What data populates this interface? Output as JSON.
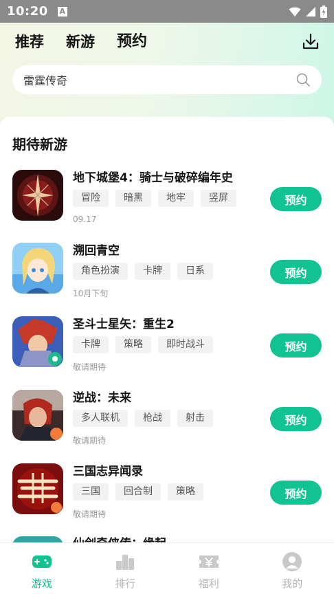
{
  "status_bar": {
    "time": "10:20",
    "notification_badge": "A",
    "icons": [
      "wifi-icon",
      "signal-icon",
      "battery-charging-icon"
    ]
  },
  "header": {
    "tabs": [
      {
        "label": "推荐",
        "active": false
      },
      {
        "label": "新游",
        "active": false
      },
      {
        "label": "预约",
        "active": true
      }
    ],
    "download_icon": "download-icon"
  },
  "search": {
    "text": "雷霆传奇",
    "icon": "search-icon"
  },
  "section": {
    "title": "期待新游"
  },
  "games": [
    {
      "name": "地下城堡4：骑士与破碎编年史",
      "tags": [
        "冒险",
        "暗黑",
        "地牢",
        "竖屏"
      ],
      "date": "09.17",
      "button": "预约"
    },
    {
      "name": "溯回青空",
      "tags": [
        "角色扮演",
        "卡牌",
        "日系"
      ],
      "date": "10月下旬",
      "button": "预约"
    },
    {
      "name": "圣斗士星矢：重生2",
      "tags": [
        "卡牌",
        "策略",
        "即时战斗"
      ],
      "date": "敬请期待",
      "button": "预约"
    },
    {
      "name": "逆战：未来",
      "tags": [
        "多人联机",
        "枪战",
        "射击"
      ],
      "date": "敬请期待",
      "button": "预约"
    },
    {
      "name": "三国志异闻录",
      "tags": [
        "三国",
        "回合制",
        "策略"
      ],
      "date": "敬请期待",
      "button": "预约"
    },
    {
      "name": "仙剑奇侠传：缘起",
      "tags": [],
      "date": "",
      "button": ""
    }
  ],
  "bottom_nav": [
    {
      "label": "游戏",
      "icon": "gamepad-icon",
      "active": true
    },
    {
      "label": "排行",
      "icon": "ranking-icon",
      "active": false
    },
    {
      "label": "福利",
      "icon": "ticket-icon",
      "active": false
    },
    {
      "label": "我的",
      "icon": "profile-icon",
      "active": false
    }
  ],
  "colors": {
    "accent": "#10c391",
    "tab_highlight": "#3fe0b2",
    "nav_inactive": "#b5b5b5"
  }
}
